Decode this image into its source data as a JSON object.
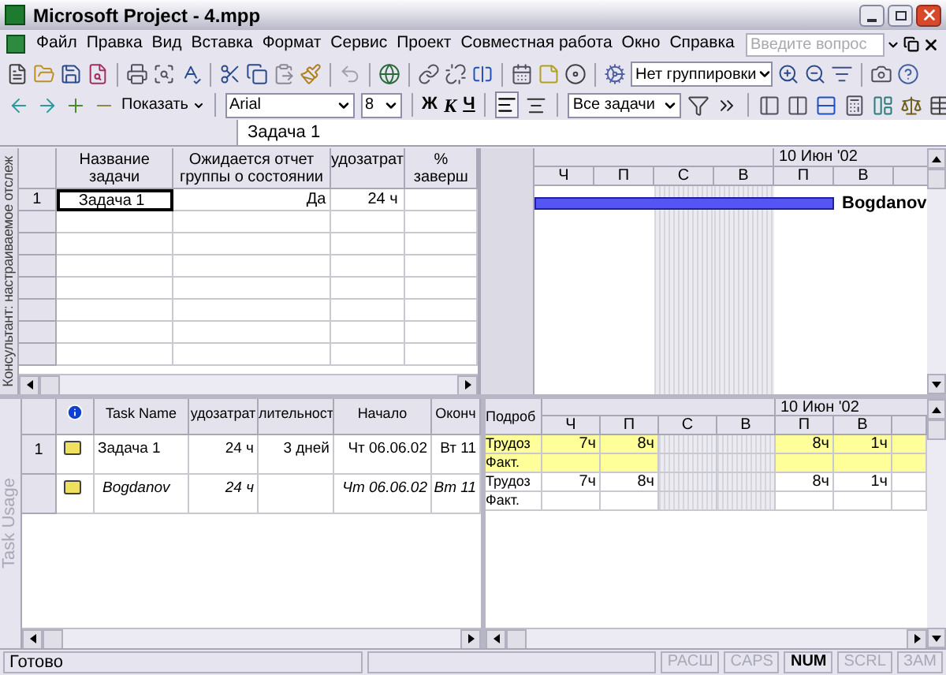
{
  "window": {
    "title": "Microsoft Project - 4.mpp"
  },
  "menu": [
    "Файл",
    "Правка",
    "Вид",
    "Вставка",
    "Формат",
    "Сервис",
    "Проект",
    "Совместная работа",
    "Окно",
    "Справка"
  ],
  "help_search": {
    "placeholder": "Введите вопрос"
  },
  "toolbar": {
    "grouping": "Нет группировки",
    "show": "Показать",
    "font": "Arial",
    "size": "8",
    "bold": "Ж",
    "italic": "К",
    "underline": "Ч",
    "align_left_pressed": true,
    "filter": "Все задачи"
  },
  "entry_bar": {
    "value": "Задача 1"
  },
  "top_grid": {
    "side_label": "Консультант: настраиваемое отслеж",
    "columns": [
      "Название задачи",
      "Ожидается отчет группы о состоянии",
      "удозатрат",
      "% заверш"
    ],
    "rows": [
      {
        "id": "1",
        "name": "Задача 1",
        "status_report": "Да",
        "work": "24 ч",
        "selected": true
      }
    ]
  },
  "gantt": {
    "month": "10 Июн '02",
    "days": [
      {
        "label": "Ч",
        "nonworking": false
      },
      {
        "label": "П",
        "nonworking": false
      },
      {
        "label": "С",
        "nonworking": true
      },
      {
        "label": "В",
        "nonworking": true
      },
      {
        "label": "П",
        "nonworking": false
      },
      {
        "label": "В",
        "nonworking": false
      }
    ],
    "bars": [
      {
        "resource": "Bogdanov"
      }
    ]
  },
  "usage_table": {
    "side_label": "Task Usage",
    "columns": [
      "Task Name",
      "удозатрат",
      "лительност",
      "Начало",
      "Оконч"
    ],
    "rows": [
      {
        "id": "1",
        "kind": "task",
        "name": "Задача 1",
        "work": "24 ч",
        "duration": "3 дней",
        "start": "Чт 06.06.02",
        "finish": "Вт 11"
      },
      {
        "kind": "assignment",
        "name": "Bogdanov",
        "work": "24 ч",
        "start": "Чт 06.06.02",
        "finish": "Вт 11"
      }
    ]
  },
  "usage_grid": {
    "details_header": "Подроб",
    "month": "10 Июн '02",
    "days": [
      {
        "label": "Ч",
        "nonworking": false
      },
      {
        "label": "П",
        "nonworking": false
      },
      {
        "label": "С",
        "nonworking": true
      },
      {
        "label": "В",
        "nonworking": true
      },
      {
        "label": "П",
        "nonworking": false
      },
      {
        "label": "В",
        "nonworking": false
      }
    ],
    "rows": [
      {
        "label": "Трудоз",
        "highlighted": true,
        "working_day_values": [
          "7ч",
          "8ч",
          "8ч",
          "1ч"
        ]
      },
      {
        "label": "Факт.",
        "highlighted": true
      },
      {
        "label": "Трудоз",
        "highlighted": false,
        "working_day_values": [
          "7ч",
          "8ч",
          "8ч",
          "1ч"
        ]
      },
      {
        "label": "Факт.",
        "highlighted": false
      }
    ]
  },
  "status_bar": {
    "text": "Готово",
    "indicators": [
      {
        "label": "РАСШ",
        "active": false
      },
      {
        "label": "CAPS",
        "active": false
      },
      {
        "label": "NUM",
        "active": true
      },
      {
        "label": "SCRL",
        "active": false
      },
      {
        "label": "ЗАМ",
        "active": false
      }
    ]
  }
}
